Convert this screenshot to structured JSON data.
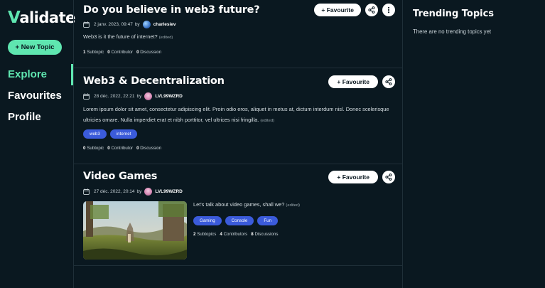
{
  "app": {
    "logo_prefix": "V",
    "logo_rest": "alidate"
  },
  "sidebar": {
    "new_topic_label": "+ New Topic",
    "items": [
      {
        "label": "Explore",
        "active": true
      },
      {
        "label": "Favourites",
        "active": false
      },
      {
        "label": "Profile",
        "active": false
      }
    ]
  },
  "posts": [
    {
      "title": "Do you believe in web3 future?",
      "favourite_label": "+ Favourite",
      "date": "2 janv. 2023, 09:47",
      "by": "by",
      "author": "charlesiev",
      "body": "Web3 is it the future of internet?",
      "edited": "(edited)",
      "stats": {
        "subtopics": "1",
        "subtopics_label": "Subtopic",
        "contributors": "0",
        "contributors_label": "Contributor",
        "discussions": "0",
        "discussions_label": "Discussion"
      }
    },
    {
      "title": "Web3 & Decentralization",
      "favourite_label": "+ Favourite",
      "date": "28 déc. 2022, 22:21",
      "by": "by",
      "author": "LVL99WZRD",
      "body": "Lorem ipsum dolor sit amet, consectetur adipiscing elit. Proin odio eros, aliquet in metus at, dictum interdum nisl. Donec scelerisque ultricies ornare. Nulla imperdiet erat et nibh porttitor, vel ultrices nisi fringilla.",
      "edited": "(edited)",
      "tags": [
        "web3",
        "internet"
      ],
      "stats": {
        "subtopics": "0",
        "subtopics_label": "Subtopic",
        "contributors": "0",
        "contributors_label": "Contributor",
        "discussions": "0",
        "discussions_label": "Discussion"
      }
    },
    {
      "title": "Video Games",
      "favourite_label": "+ Favourite",
      "date": "27 déc. 2022, 20:14",
      "by": "by",
      "author": "LVL99WZRD",
      "body": "Let's talk about video games, shall we?",
      "edited": "(edited)",
      "tags": [
        "Gaming",
        "Console",
        "Fun"
      ],
      "stats": {
        "subtopics": "2",
        "subtopics_label": "Subtopics",
        "contributors": "4",
        "contributors_label": "Contributors",
        "discussions": "8",
        "discussions_label": "Discussions"
      }
    }
  ],
  "trending": {
    "title": "Trending Topics",
    "empty": "There are no trending topics yet"
  },
  "colors": {
    "background": "#0a1820",
    "accent": "#5fe6b0",
    "tag": "#3b5bdb",
    "divider": "#1f2f38"
  },
  "icons": {
    "share": "share-icon",
    "more": "more-vertical-icon",
    "calendar": "calendar-icon"
  }
}
